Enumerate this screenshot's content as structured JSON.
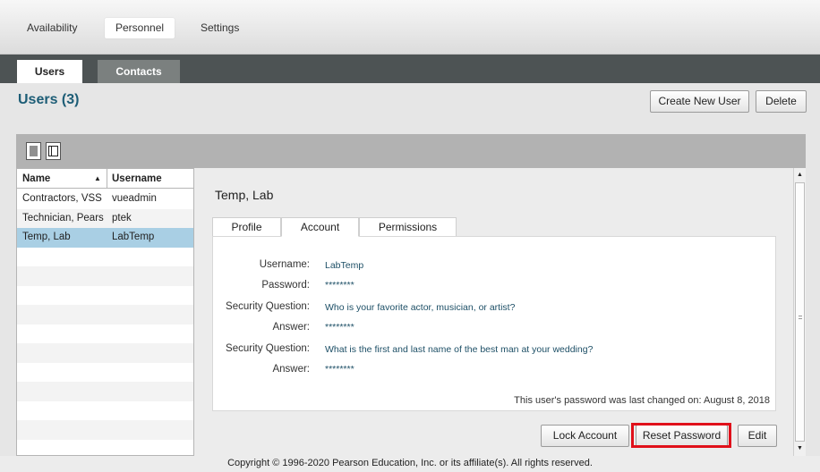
{
  "top_tabs": [
    "Availability",
    "Personnel",
    "Settings"
  ],
  "sub_tabs": [
    "Users",
    "Contacts"
  ],
  "page": {
    "title": "Users (3)",
    "create_button": "Create New User",
    "delete_button": "Delete"
  },
  "list": {
    "columns": [
      "Name",
      "Username"
    ],
    "sort_indicator": "▲",
    "rows": [
      {
        "name": "Contractors, VSS",
        "username": "vueadmin"
      },
      {
        "name": "Technician, Pears",
        "username": "ptek"
      },
      {
        "name": "Temp, Lab",
        "username": "LabTemp"
      }
    ],
    "selected_index": 2
  },
  "detail": {
    "title": "Temp, Lab",
    "tabs": [
      "Profile",
      "Account",
      "Permissions"
    ],
    "active_tab": "Account",
    "fields": [
      {
        "label": "Username:",
        "value": "LabTemp"
      },
      {
        "label": "Password:",
        "value": "********"
      },
      {
        "label": "Security Question:",
        "value": "Who is your favorite actor, musician, or artist?"
      },
      {
        "label": "Answer:",
        "value": "********"
      },
      {
        "label": "Security Question:",
        "value": "What is the first and last name of the best man at your wedding?"
      },
      {
        "label": "Answer:",
        "value": "********"
      }
    ],
    "last_changed": "This user's password was last changed on: August 8, 2018",
    "buttons": {
      "lock": "Lock Account",
      "reset": "Reset Password",
      "edit": "Edit"
    }
  },
  "footer": "Copyright © 1996-2020 Pearson Education, Inc. or its affiliate(s). All rights reserved.",
  "colors": {
    "title": "#1d5d76",
    "selected_row": "#a9cfe4",
    "highlight": "#e0101a",
    "sub_bar": "#4d5354"
  }
}
